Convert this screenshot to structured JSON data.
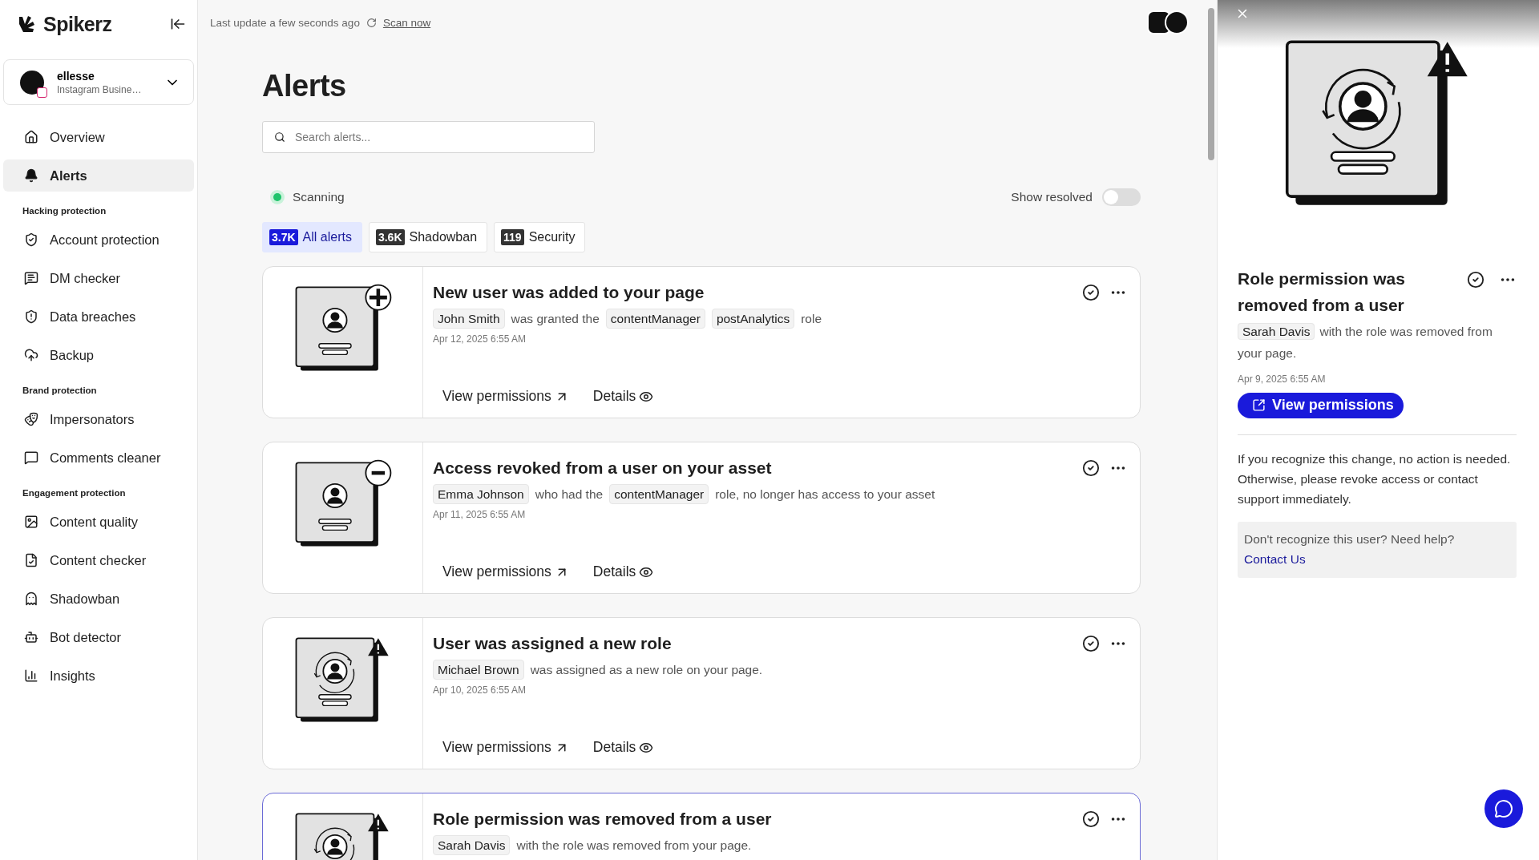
{
  "sidebar": {
    "brand": "Spikerz",
    "account": {
      "name": "ellesse",
      "type": "Instagram Busine…"
    },
    "sections": [
      {
        "items": [
          {
            "label": "Overview",
            "selected": false
          },
          {
            "label": "Alerts",
            "selected": true
          }
        ]
      },
      {
        "heading": "Hacking protection",
        "items": [
          {
            "label": "Account protection",
            "selected": false
          },
          {
            "label": "DM checker",
            "selected": false
          },
          {
            "label": "Data breaches",
            "selected": false
          },
          {
            "label": "Backup",
            "selected": false
          }
        ]
      },
      {
        "heading": "Brand protection",
        "items": [
          {
            "label": "Impersonators",
            "selected": false
          },
          {
            "label": "Comments cleaner",
            "selected": false
          }
        ]
      },
      {
        "heading": "Engagement protection",
        "items": [
          {
            "label": "Content quality",
            "selected": false
          },
          {
            "label": "Content checker",
            "selected": false
          },
          {
            "label": "Shadowban",
            "selected": false
          },
          {
            "label": "Bot detector",
            "selected": false
          },
          {
            "label": "Insights",
            "selected": false
          }
        ]
      }
    ]
  },
  "topbar": {
    "last_update": "Last update a few seconds ago",
    "scan_link": "Scan now"
  },
  "main": {
    "title": "Alerts",
    "search": {
      "placeholder": "Search alerts..."
    },
    "status": {
      "label": "Scanning",
      "on": true
    },
    "show_resolved": {
      "label": "Show resolved",
      "on": false
    },
    "tabs": [
      {
        "count": "3.7K",
        "label": "All alerts",
        "selected": true
      },
      {
        "count": "3.6K",
        "label": "Shadowban",
        "selected": false
      },
      {
        "count": "119",
        "label": "Security",
        "selected": false
      }
    ],
    "alerts": [
      {
        "kind": "added",
        "selected": false,
        "title": "New user was added to your page",
        "segments": [
          {
            "kind": "chip",
            "text": "John Smith"
          },
          {
            "kind": "text",
            "text": "was granted the"
          },
          {
            "kind": "chip",
            "text": "contentManager"
          },
          {
            "kind": "chip",
            "text": "postAnalytics"
          },
          {
            "kind": "text",
            "text": "role"
          }
        ],
        "date": "Apr 12, 2025 6:55 AM",
        "actions": [
          "View permissions",
          "Details"
        ]
      },
      {
        "kind": "revoked",
        "selected": false,
        "title": "Access revoked from a user on your asset",
        "segments": [
          {
            "kind": "chip",
            "text": "Emma Johnson"
          },
          {
            "kind": "text",
            "text": "who had the"
          },
          {
            "kind": "chip",
            "text": "contentManager"
          },
          {
            "kind": "text",
            "text": "role, no longer has access to your asset"
          }
        ],
        "date": "Apr 11, 2025 6:55 AM",
        "actions": [
          "View permissions",
          "Details"
        ]
      },
      {
        "kind": "role",
        "selected": false,
        "title": "User was assigned a new role",
        "segments": [
          {
            "kind": "chip",
            "text": "Michael Brown"
          },
          {
            "kind": "text",
            "text": "was assigned as a new role on your page."
          }
        ],
        "date": "Apr 10, 2025 6:55 AM",
        "actions": [
          "View permissions",
          "Details"
        ]
      },
      {
        "kind": "role",
        "selected": true,
        "title": "Role permission was removed from a user",
        "segments": [
          {
            "kind": "chip",
            "text": "Sarah Davis"
          },
          {
            "kind": "text",
            "text": "with the role was removed from your page."
          }
        ]
      }
    ]
  },
  "detail": {
    "kind": "role",
    "title": "Role permission was removed from a user",
    "segments": [
      {
        "kind": "chip",
        "text": "Sarah Davis"
      },
      {
        "kind": "text",
        "text": "with the role was removed from your page."
      }
    ],
    "date": "Apr 9, 2025 6:55 AM",
    "button": "View permissions",
    "note": "If you recognize this change, no action is needed. Otherwise, please revoke access or contact support immediately.",
    "help": "Don't recognize this user? Need help?",
    "help_link": "Contact Us"
  }
}
